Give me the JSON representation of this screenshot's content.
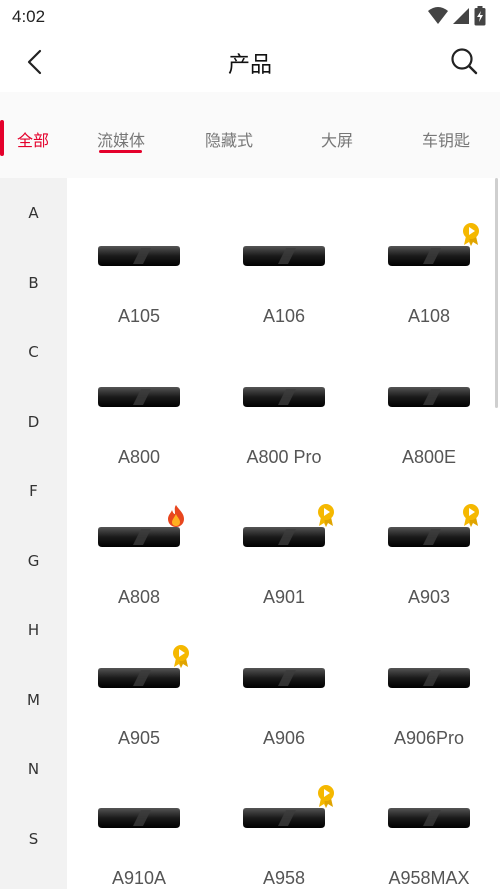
{
  "status": {
    "time": "4:02",
    "icons": [
      "wifi-icon",
      "signal-icon",
      "battery-icon"
    ]
  },
  "header": {
    "title": "产品",
    "back_icon": "chevron-left-icon",
    "search_icon": "search-icon"
  },
  "tabs": [
    {
      "label": "全部",
      "active": true
    },
    {
      "label": "流媒体",
      "active": false,
      "underlined": true
    },
    {
      "label": "隐藏式",
      "active": false
    },
    {
      "label": "大屏",
      "active": false
    },
    {
      "label": "车钥匙",
      "active": false
    }
  ],
  "index_letters": [
    "A",
    "B",
    "C",
    "D",
    "F",
    "G",
    "H",
    "M",
    "N",
    "S"
  ],
  "products": [
    {
      "name": "A105",
      "badge": ""
    },
    {
      "name": "A106",
      "badge": ""
    },
    {
      "name": "A108",
      "badge": "award"
    },
    {
      "name": "A800",
      "badge": ""
    },
    {
      "name": "A800 Pro",
      "badge": ""
    },
    {
      "name": "A800E",
      "badge": ""
    },
    {
      "name": "A808",
      "badge": "hot"
    },
    {
      "name": "A901",
      "badge": "award"
    },
    {
      "name": "A903",
      "badge": "award"
    },
    {
      "name": "A905",
      "badge": "award"
    },
    {
      "name": "A906",
      "badge": ""
    },
    {
      "name": "A906Pro",
      "badge": ""
    },
    {
      "name": "A910A",
      "badge": ""
    },
    {
      "name": "A958",
      "badge": "award"
    },
    {
      "name": "A958MAX",
      "badge": ""
    }
  ],
  "colors": {
    "accent": "#e4002b",
    "badge_gold": "#f5b800"
  }
}
